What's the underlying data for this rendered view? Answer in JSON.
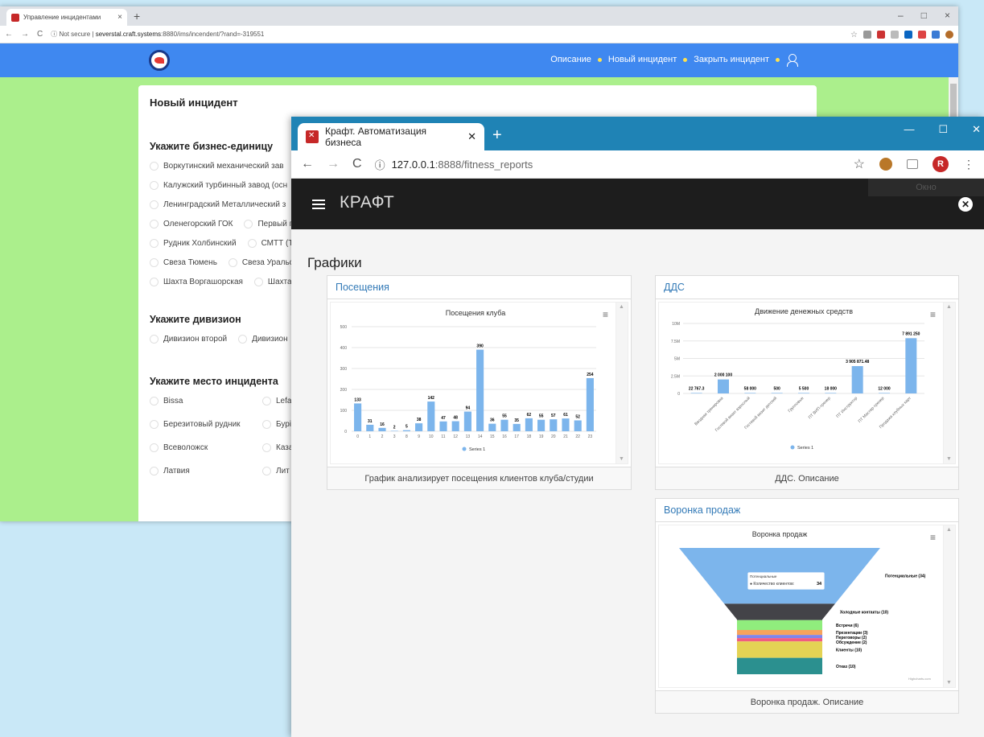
{
  "back_window": {
    "tab_title": "Управление инцидентами",
    "tab_close": "×",
    "new_tab": "+",
    "window_controls": [
      "–",
      "□",
      "×"
    ],
    "nav_icons": [
      "←",
      "→",
      "C"
    ],
    "security_label": "Not secure",
    "url_host": "severstal.craft.systems",
    "url_path": ":8880/ims/incendent/?rand=-319551",
    "nav_links": [
      "Описание",
      "Новый инцидент",
      "Закрыть инцидент"
    ],
    "form_title": "Новый инцидент",
    "business_unit": {
      "heading": "Укажите бизнес-единицу",
      "rows": [
        [
          "Воркутинский механический зав"
        ],
        [
          "Калужский турбинный завод (осн"
        ],
        [
          "Ленинградский Металлический з"
        ],
        [
          "Оленегорский ГОК",
          "Первый п"
        ],
        [
          "Рудник Холбинский",
          "СМТТ (Те"
        ],
        [
          "Свеза Тюмень",
          "Свеза Уральск"
        ],
        [
          "Шахта Воргашорская",
          "Шахта"
        ]
      ]
    },
    "division": {
      "heading": "Укажите дивизион",
      "rows": [
        [
          "Дивизион второй",
          "Дивизион"
        ]
      ]
    },
    "place": {
      "heading": "Укажите место инцидента",
      "items": [
        "Bissa",
        "Lefa",
        "Березитовый рудник",
        "Бурі",
        "Всеволожск",
        "Каза",
        "Латвия",
        "Лит"
      ]
    }
  },
  "front_window": {
    "tab_title": "Крафт. Автоматизация бизнеса",
    "tab_close": "✕",
    "new_tab": "+",
    "window_controls": [
      "—",
      "☐",
      "✕"
    ],
    "nav_icons": [
      "←",
      "→",
      "C"
    ],
    "info_icon": "ⓘ",
    "url_host": "127.0.0.1",
    "url_path": ":8888/fitness_reports",
    "star": "☆",
    "avatar_letter": "R",
    "menu_dots": "⋮",
    "app_title": "КРАФТ",
    "tooltip_text": "Окно",
    "close_symbol": "✕",
    "page_title": "Графики"
  },
  "cards": {
    "visits": {
      "title": "Посещения",
      "footer": "График анализирует посещения клиентов клуба/студии",
      "menu": "≡"
    },
    "dds": {
      "title": "ДДС",
      "footer": "ДДС. Описание",
      "menu": "≡"
    },
    "funnel": {
      "title": "Воронка продаж",
      "footer": "Воронка продаж. Описание",
      "menu": "≡",
      "credit": "Highcharts.com"
    }
  },
  "chart_data": [
    {
      "type": "bar",
      "title": "Посещения клуба",
      "categories": [
        "0",
        "1",
        "2",
        "3",
        "8",
        "9",
        "10",
        "11",
        "12",
        "13",
        "14",
        "15",
        "16",
        "17",
        "18",
        "19",
        "20",
        "21",
        "22",
        "23"
      ],
      "series": [
        {
          "name": "Series 1",
          "values": [
            133,
            31,
            16,
            2,
            5,
            38,
            142,
            47,
            48,
            94,
            390,
            36,
            55,
            35,
            62,
            55,
            57,
            61,
            52,
            254
          ]
        }
      ],
      "y_ticks": [
        "0",
        "100",
        "200",
        "300",
        "400",
        "500"
      ],
      "ylim": [
        0,
        500
      ],
      "color": "#7cb5ec",
      "legend": "bottom-center",
      "grid": true
    },
    {
      "type": "bar",
      "title": "Движение денежных средств",
      "categories": [
        "Вводная тренировка",
        "Гостевой визит взрослый",
        "Гостевой визит детский",
        "Групповые",
        "ПТ ВИП-тренер",
        "ПТ Инструктор",
        "ПТ Мастер-тренер",
        "Продажа клубных карт"
      ],
      "series": [
        {
          "name": "Series 1",
          "values": [
            22767.3,
            2000100,
            58000,
            500,
            5500,
            18000,
            3905871.48,
            12000,
            7891250
          ]
        }
      ],
      "data_labels": [
        "22 767.3",
        "2 000 100",
        "58 000",
        "500",
        "5 500",
        "18 000",
        "3 905 871.48",
        "12 000",
        "7 891 250"
      ],
      "y_ticks": [
        "0",
        "2.5M",
        "5M",
        "7.5M",
        "10M"
      ],
      "ylim": [
        0,
        10000000
      ],
      "color": "#7cb5ec",
      "legend": "bottom-center",
      "grid": true
    },
    {
      "type": "funnel",
      "title": "Воронка продаж",
      "stages": [
        {
          "label": "Потенциальные (34)",
          "value": 34,
          "color": "#7cb5ec"
        },
        {
          "label": "Холодные контакты (10)",
          "value": 10,
          "color": "#434348"
        },
        {
          "label": "Встречи (6)",
          "value": 6,
          "color": "#90ed7d"
        },
        {
          "label": "Презентации (3)",
          "value": 3,
          "color": "#f7a35c"
        },
        {
          "label": "Переговоры (2)",
          "value": 2,
          "color": "#8085e9"
        },
        {
          "label": "Обсуждение (2)",
          "value": 2,
          "color": "#f15c80"
        },
        {
          "label": "Клиенты (10)",
          "value": 10,
          "color": "#e4d354"
        },
        {
          "label": "Отказ (10)",
          "value": 10,
          "color": "#2b908f"
        }
      ],
      "tooltip": {
        "title": "Потенциальные",
        "text": "● Количество клиентов:",
        "value": "34"
      }
    }
  ]
}
